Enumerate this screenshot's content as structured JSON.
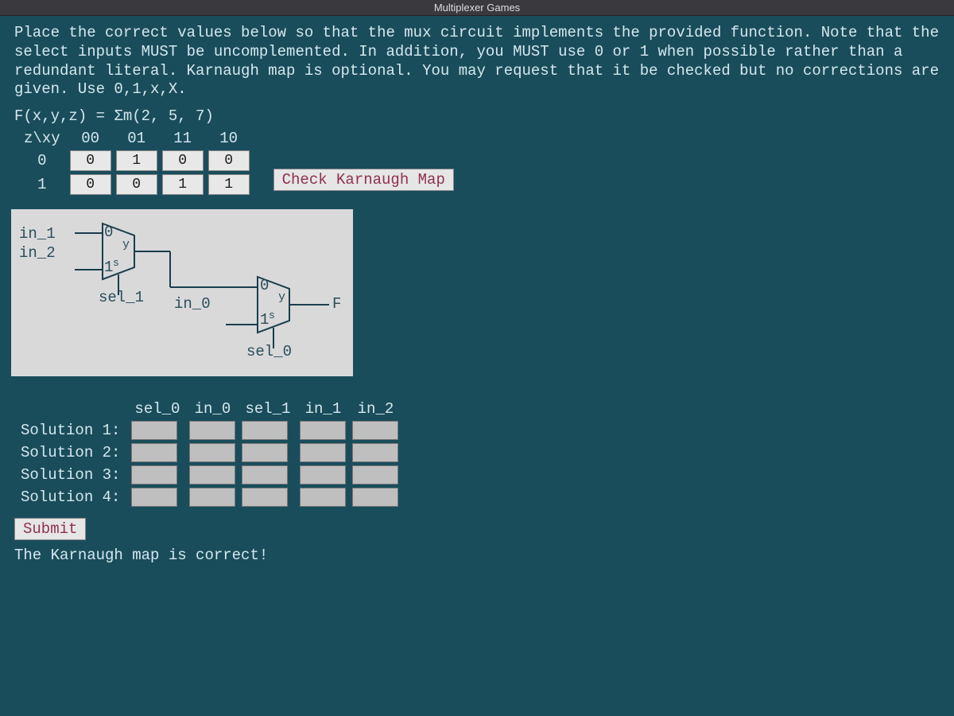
{
  "window": {
    "title": "Multiplexer Games"
  },
  "instructions": "Place the correct values below so that the mux circuit implements the provided function. Note that the select inputs MUST be uncomplemented. In addition, you MUST use 0 or 1 when possible rather than a redundant literal. Karnaugh map is optional. You may request that it be checked but no corrections are given. Use 0,1,x,X.",
  "function_def": "F(x,y,z) = Σm(2, 5, 7)",
  "kmap": {
    "row_var": "z\\xy",
    "col_headers": [
      "00",
      "01",
      "11",
      "10"
    ],
    "row_headers": [
      "0",
      "1"
    ],
    "cells": [
      [
        "0",
        "1",
        "0",
        "0"
      ],
      [
        "0",
        "0",
        "1",
        "1"
      ]
    ]
  },
  "buttons": {
    "check": "Check Karnaugh Map",
    "submit": "Submit"
  },
  "circuit": {
    "in_1": "in_1",
    "in_2": "in_2",
    "sel_1": "sel_1",
    "in_0": "in_0",
    "sel_0": "sel_0",
    "out": "F",
    "mux_lbl0": "0",
    "mux_lbl1": "1",
    "mux_y": "y",
    "mux_s": "s"
  },
  "solutions": {
    "headers": [
      "sel_0",
      "in_0",
      "sel_1",
      "in_1",
      "in_2"
    ],
    "rows": [
      {
        "label": "Solution 1:",
        "values": [
          "",
          "",
          "",
          "",
          ""
        ]
      },
      {
        "label": "Solution 2:",
        "values": [
          "",
          "",
          "",
          "",
          ""
        ]
      },
      {
        "label": "Solution 3:",
        "values": [
          "",
          "",
          "",
          "",
          ""
        ]
      },
      {
        "label": "Solution 4:",
        "values": [
          "",
          "",
          "",
          "",
          ""
        ]
      }
    ]
  },
  "status": "The Karnaugh map is correct!"
}
